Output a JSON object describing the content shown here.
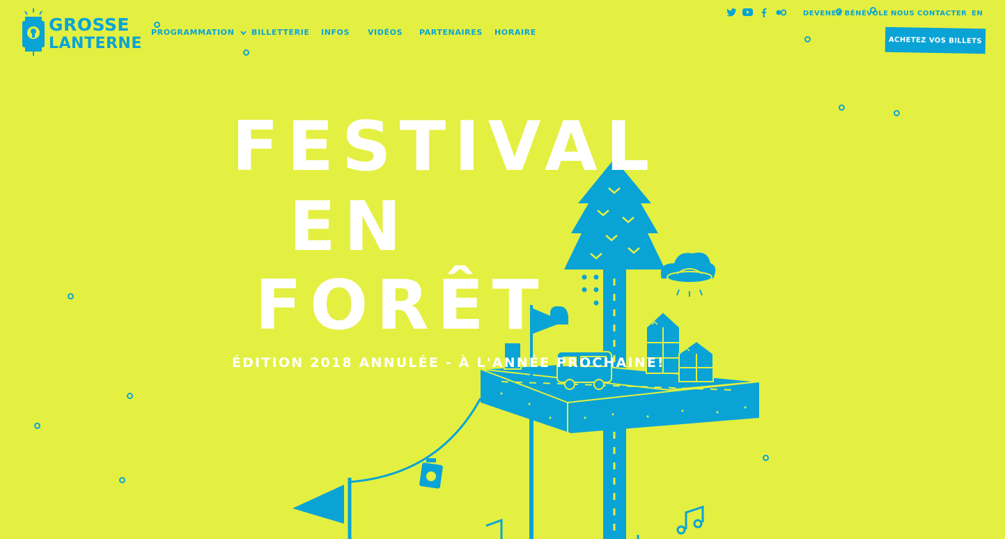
{
  "logo": {
    "line1": "GROSSE",
    "line2": "LANTERNE"
  },
  "nav": {
    "programmation": "PROGRAMMATION",
    "billetterie": "BILLETTERIE",
    "infos": "INFOS",
    "videos": "VIDÉOS",
    "partenaires": "PARTENAIRES",
    "horaire": "HORAIRE"
  },
  "utility": {
    "benevole": "DEVENEZ BÉNÉVOLE",
    "contact": "NOUS CONTACTER",
    "lang": "EN"
  },
  "social_icons": [
    "twitter-icon",
    "youtube-icon",
    "facebook-icon",
    "flickr-icon"
  ],
  "cta": {
    "buy": "ACHETEZ VOS BILLETS"
  },
  "hero": {
    "line1": "FESTIVAL",
    "line2": "EN",
    "line3": "FORÊT",
    "subtitle": "ÉDITION 2018 ANNULÉE - À L'ANNÉE PROCHAINE!"
  },
  "colors": {
    "background": "#E3F041",
    "accent": "#0AA3D6",
    "hero_text": "#FFFFFF"
  }
}
